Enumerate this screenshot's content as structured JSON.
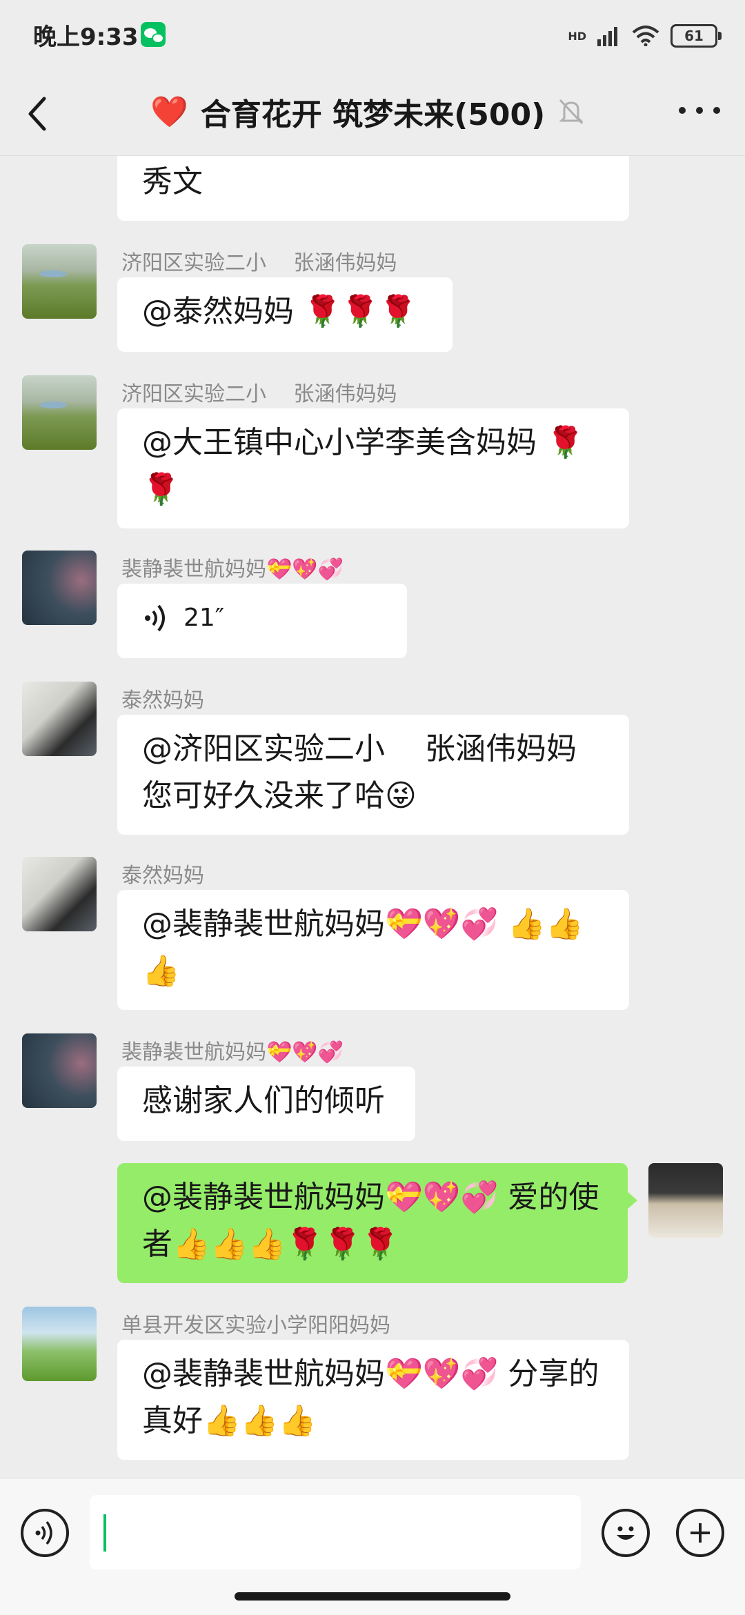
{
  "status": {
    "time": "晚上9:33",
    "battery": "61",
    "network": "HD"
  },
  "header": {
    "title": "合育花开 筑梦未来(500)",
    "title_emoji": "❤️"
  },
  "messages": [
    {
      "text": "秀文"
    },
    {
      "sender": "济阳区实验二小　 张涵伟妈妈",
      "text": "@泰然妈妈 🌹🌹🌹"
    },
    {
      "sender": "济阳区实验二小　 张涵伟妈妈",
      "text": "@大王镇中心小学李美含妈妈 🌹🌹"
    },
    {
      "sender": "裴静裴世航妈妈💝💖💞",
      "text": "21″"
    },
    {
      "sender": "泰然妈妈",
      "text": "@济阳区实验二小　 张涵伟妈妈 您可好久没来了哈😜"
    },
    {
      "sender": "泰然妈妈",
      "text": "@裴静裴世航妈妈💝💖💞 👍👍👍"
    },
    {
      "sender": "裴静裴世航妈妈💝💖💞",
      "text": "感谢家人们的倾听"
    },
    {
      "text": "@裴静裴世航妈妈💝💖💞 爱的使者👍👍👍🌹🌹🌹"
    },
    {
      "sender": "单县开发区实验小学阳阳妈妈",
      "text": "@裴静裴世航妈妈💝💖💞 分享的真好👍👍👍"
    }
  ],
  "icons": {
    "back": "chevron-left-icon",
    "mute": "bell-off-icon",
    "more": "more-dots-icon",
    "voice": "voice-icon",
    "emoji": "emoji-icon",
    "plus": "plus-icon"
  },
  "colors": {
    "self_bubble": "#95ec69",
    "other_bubble": "#ffffff",
    "background": "#ededed",
    "caret": "#07c160"
  }
}
